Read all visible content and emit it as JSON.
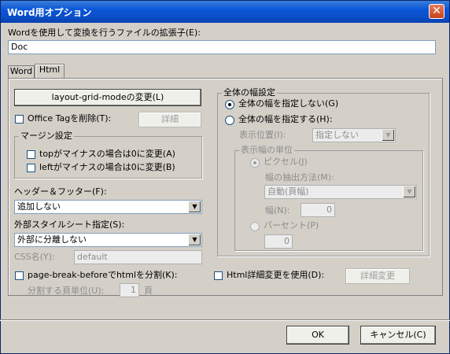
{
  "window": {
    "title": "Word用オプション",
    "close_glyph": "✕"
  },
  "extension": {
    "label": "Wordを使用して変換を行うファイルの拡張子(E):",
    "value": "Doc"
  },
  "tabs": [
    {
      "label": "Word",
      "active": false
    },
    {
      "label": "Html",
      "active": true
    }
  ],
  "left": {
    "layout_grid_button": "layout-grid-modeの変更(L)",
    "office_tag_checkbox": "Office Tagを削除(T):",
    "office_tag_checked": false,
    "detail_button": "詳細",
    "margin_group": {
      "title": "マージン設定",
      "top_checkbox": "topがマイナスの場合は0に変更(A)",
      "left_checkbox": "leftがマイナスの場合は0に変更(B)"
    },
    "header_footer": {
      "label": "ヘッダー＆フッター(F):",
      "value": "追加しない"
    },
    "external_style": {
      "label": "外部スタイルシート指定(S):",
      "value": "外部に分離しない"
    },
    "css_name": {
      "label": "CSS名(Y):",
      "value": "default"
    },
    "page_break": {
      "checkbox": "page-break-beforeでhtmlを分割(K):",
      "unit_label": "分割する頁単位(U):",
      "unit_value": "1",
      "unit_suffix": "頁"
    }
  },
  "right": {
    "width_group": {
      "title": "全体の幅設定",
      "radio_no_spec": "全体の幅を指定しない(G)",
      "radio_spec": "全体の幅を指定する(H):",
      "selected": "no_spec",
      "position_label": "表示位置(I):",
      "position_value": "指定しない",
      "unit_group": {
        "title": "表示幅の単位",
        "radio_pixel": "ピクセル(J)",
        "extract_label": "幅の抽出方法(M):",
        "extract_value": "自動(頁幅)",
        "width_label": "幅(N):",
        "width_value": "0",
        "radio_percent": "パーセント(P)",
        "percent_value": "0"
      }
    },
    "html_detail_checkbox": "Html詳細変更を使用(D):",
    "html_detail_button": "詳細変更"
  },
  "footer": {
    "ok": "OK",
    "cancel": "キャンセル(C)"
  },
  "icons": {
    "dropdown": "▼"
  }
}
